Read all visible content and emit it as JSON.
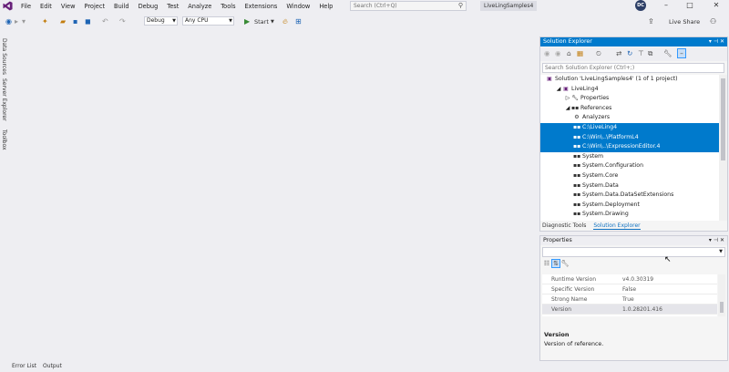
{
  "menu": [
    "File",
    "Edit",
    "View",
    "Project",
    "Build",
    "Debug",
    "Test",
    "Analyze",
    "Tools",
    "Extensions",
    "Window",
    "Help"
  ],
  "search": {
    "placeholder": "Search (Ctrl+Q)"
  },
  "project_badge": "LiveLingSamples4",
  "user_initials": "DC",
  "toolbar": {
    "config": "Debug",
    "platform": "Any CPU",
    "start_label": "Start",
    "live_share": "Live Share"
  },
  "left_rail": [
    "Data Sources",
    "Server Explorer",
    "Toolbox"
  ],
  "bottom_tabs": [
    "Error List",
    "Output"
  ],
  "solution_explorer": {
    "title": "Solution Explorer",
    "search_placeholder": "Search Solution Explorer (Ctrl+;)",
    "tree": [
      {
        "label": "Solution 'LiveLingSamples4' (1 of 1 project)",
        "indent": 0,
        "icon": "solution-icon",
        "selected": false
      },
      {
        "label": "LiveLing4",
        "indent": 1,
        "icon": "project-icon",
        "selected": false
      },
      {
        "label": "Properties",
        "indent": 2,
        "icon": "wrench-icon",
        "selected": false
      },
      {
        "label": "References",
        "indent": 2,
        "icon": "references-icon",
        "selected": false
      },
      {
        "label": "Analyzers",
        "indent": 3,
        "icon": "analyzer-icon",
        "selected": false
      },
      {
        "label": "C:\\LiveLing4",
        "indent": 3,
        "icon": "reference-icon",
        "selected": true
      },
      {
        "label": "C:\\Win\\..\\PlatformL4",
        "indent": 3,
        "icon": "reference-icon",
        "selected": true
      },
      {
        "label": "C:\\Win\\..\\ExpressionEditor.4",
        "indent": 3,
        "icon": "reference-icon",
        "selected": true
      },
      {
        "label": "System",
        "indent": 3,
        "icon": "reference-icon",
        "selected": false
      },
      {
        "label": "System.Configuration",
        "indent": 3,
        "icon": "reference-icon",
        "selected": false
      },
      {
        "label": "System.Core",
        "indent": 3,
        "icon": "reference-icon",
        "selected": false
      },
      {
        "label": "System.Data",
        "indent": 3,
        "icon": "reference-icon",
        "selected": false
      },
      {
        "label": "System.Data.DataSetExtensions",
        "indent": 3,
        "icon": "reference-icon",
        "selected": false
      },
      {
        "label": "System.Deployment",
        "indent": 3,
        "icon": "reference-icon",
        "selected": false
      },
      {
        "label": "System.Drawing",
        "indent": 3,
        "icon": "reference-icon",
        "selected": false
      }
    ],
    "tabs": [
      "Diagnostic Tools",
      "Solution Explorer"
    ],
    "active_tab": 1
  },
  "properties": {
    "title": "Properties",
    "rows": [
      {
        "key": "Runtime Version",
        "value": "v4.0.30319"
      },
      {
        "key": "Specific Version",
        "value": "False"
      },
      {
        "key": "Strong Name",
        "value": "True"
      },
      {
        "key": "Version",
        "value": "1.0.28201.416"
      }
    ],
    "description_title": "Version",
    "description_text": "Version of reference."
  },
  "colors": {
    "accent": "#007acc",
    "background": "#eeeef2"
  }
}
